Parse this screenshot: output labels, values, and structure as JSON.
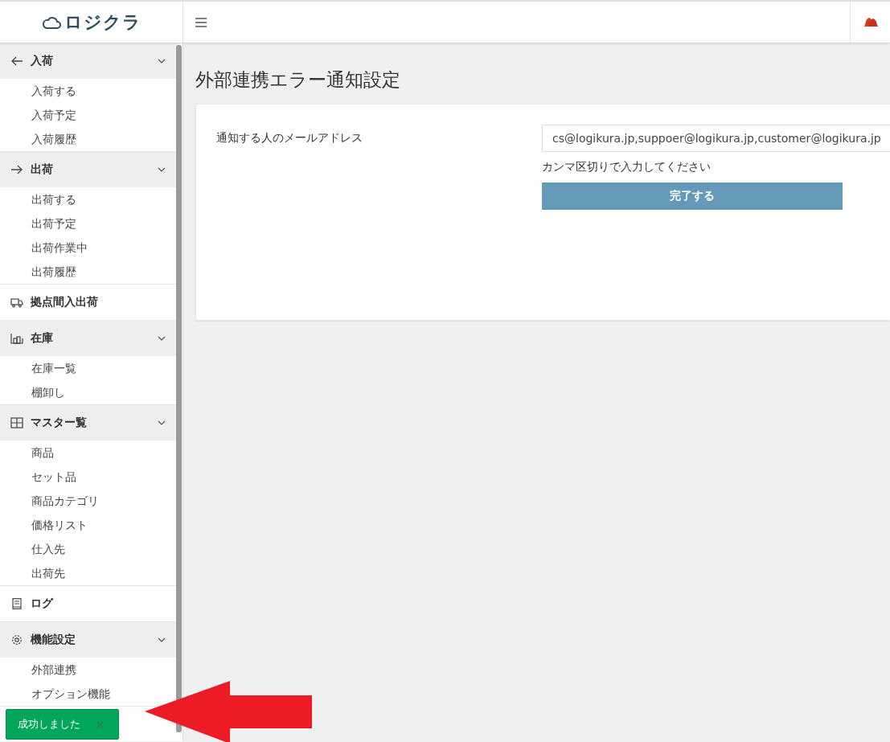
{
  "header": {
    "logo": "ロジクラ"
  },
  "sidebar": {
    "sections": [
      {
        "kind": "group",
        "label": "入荷",
        "items": [
          "入荷する",
          "入荷予定",
          "入荷履歴"
        ]
      },
      {
        "kind": "group",
        "label": "出荷",
        "items": [
          "出荷する",
          "出荷予定",
          "出荷作業中",
          "出荷履歴"
        ]
      },
      {
        "kind": "link",
        "label": "拠点間入出荷"
      },
      {
        "kind": "group",
        "label": "在庫",
        "items": [
          "在庫一覧",
          "棚卸し"
        ]
      },
      {
        "kind": "group",
        "label": "マスター覧",
        "items": [
          "商品",
          "セット品",
          "商品カテゴリ",
          "価格リスト",
          "仕入先",
          "出荷先"
        ]
      },
      {
        "kind": "link",
        "label": "ログ"
      },
      {
        "kind": "group",
        "label": "機能設定",
        "items": [
          "外部連携",
          "オプション機能"
        ]
      }
    ]
  },
  "page": {
    "title": "外部連携エラー通知設定"
  },
  "form": {
    "label": "通知する人のメールアドレス",
    "value": "cs@logikura.jp,suppoer@logikura.jp,customer@logikura.jp",
    "help": "カンマ区切りで入力してください",
    "submit": "完了する"
  },
  "toast": {
    "message": "成功しました"
  }
}
